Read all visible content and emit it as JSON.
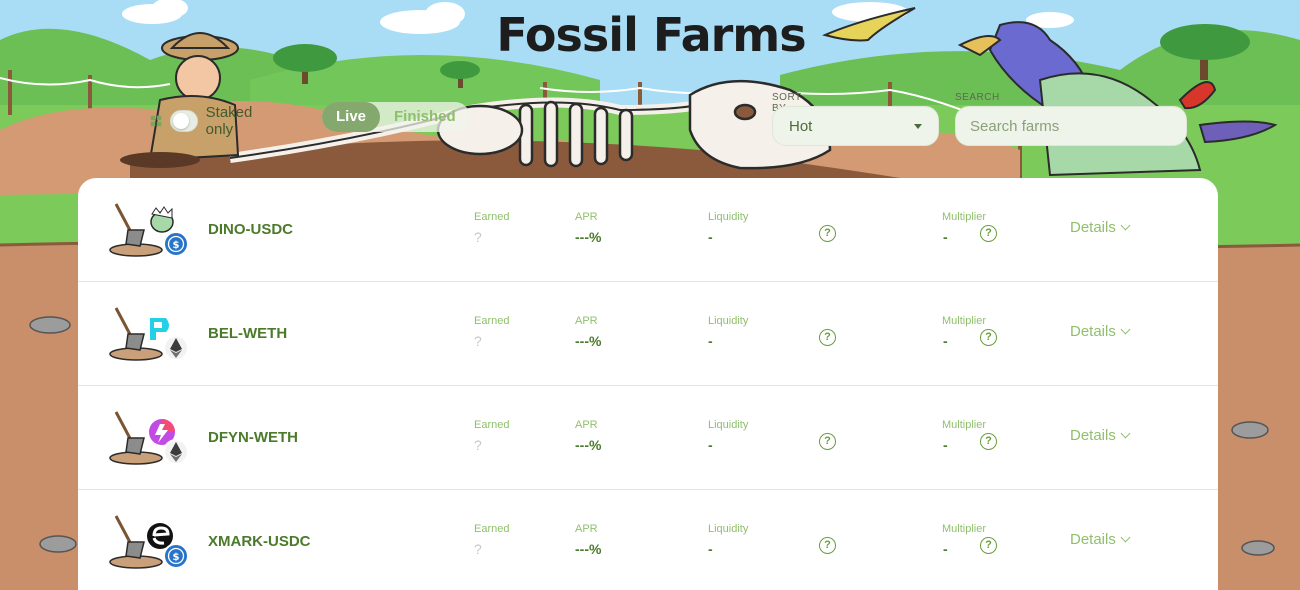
{
  "header": {
    "title": "Fossil Farms"
  },
  "filters": {
    "staked_only_label": "Staked only",
    "tabs": [
      {
        "label": "Live",
        "active": true
      },
      {
        "label": "Finished",
        "active": false
      }
    ],
    "sort_label": "SORT BY",
    "sort_value": "Hot",
    "search_label": "SEARCH",
    "search_placeholder": "Search farms"
  },
  "columns": {
    "earned": "Earned",
    "apr": "APR",
    "liquidity": "Liquidity",
    "multiplier": "Multiplier",
    "details": "Details"
  },
  "farms": [
    {
      "pair": "DINO-USDC",
      "earned": "?",
      "apr": "---%",
      "liquidity": "-",
      "multiplier": "-",
      "token_icon": "usdc-icon"
    },
    {
      "pair": "BEL-WETH",
      "earned": "?",
      "apr": "---%",
      "liquidity": "-",
      "multiplier": "-",
      "token_icon": "eth-icon"
    },
    {
      "pair": "DFYN-WETH",
      "earned": "?",
      "apr": "---%",
      "liquidity": "-",
      "multiplier": "-",
      "token_icon": "eth-icon"
    },
    {
      "pair": "XMARK-USDC",
      "earned": "?",
      "apr": "---%",
      "liquidity": "-",
      "multiplier": "-",
      "token_icon": "usdc-icon"
    }
  ],
  "help_glyph": "?",
  "colors": {
    "accent": "#84a86d",
    "pair_text": "#4c7a2b",
    "label_text": "#8fbf6c",
    "sky": "#a9dcf5",
    "grass": "#7ccb5a",
    "dirt": "#c98e6a"
  }
}
